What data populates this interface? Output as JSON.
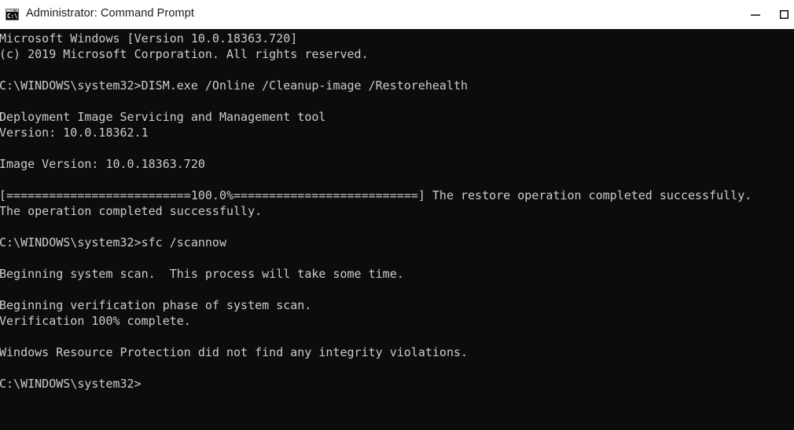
{
  "window": {
    "title": "Administrator: Command Prompt",
    "icon": "cmd-prompt-icon",
    "background_color": "#0c0c0c",
    "text_color": "#cccccc",
    "titlebar_color": "#ffffff",
    "titlebar_text_color": "#1a1a1a",
    "controls": {
      "minimize_label": "—",
      "maximize_label": "□",
      "minimize_name": "minimize-button",
      "maximize_name": "maximize-button"
    }
  },
  "console": {
    "prompt": "C:\\WINDOWS\\system32>",
    "lines": [
      "Microsoft Windows [Version 10.0.18363.720]",
      "(c) 2019 Microsoft Corporation. All rights reserved.",
      "",
      "C:\\WINDOWS\\system32>DISM.exe /Online /Cleanup-image /Restorehealth",
      "",
      "Deployment Image Servicing and Management tool",
      "Version: 10.0.18362.1",
      "",
      "Image Version: 10.0.18363.720",
      "",
      "[==========================100.0%==========================] The restore operation completed successfully.",
      "The operation completed successfully.",
      "",
      "C:\\WINDOWS\\system32>sfc /scannow",
      "",
      "Beginning system scan.  This process will take some time.",
      "",
      "Beginning verification phase of system scan.",
      "Verification 100% complete.",
      "",
      "Windows Resource Protection did not find any integrity violations.",
      "",
      "C:\\WINDOWS\\system32>"
    ],
    "full_text": "Microsoft Windows [Version 10.0.18363.720]\n(c) 2019 Microsoft Corporation. All rights reserved.\n\nC:\\WINDOWS\\system32>DISM.exe /Online /Cleanup-image /Restorehealth\n\nDeployment Image Servicing and Management tool\nVersion: 10.0.18362.1\n\nImage Version: 10.0.18363.720\n\n[==========================100.0%==========================] The restore operation completed successfully.\nThe operation completed successfully.\n\nC:\\WINDOWS\\system32>sfc /scannow\n\nBeginning system scan.  This process will take some time.\n\nBeginning verification phase of system scan.\nVerification 100% complete.\n\nWindows Resource Protection did not find any integrity violations.\n\nC:\\WINDOWS\\system32>",
    "commands_run": [
      "DISM.exe /Online /Cleanup-image /Restorehealth",
      "sfc /scannow"
    ],
    "dism": {
      "tool_name": "Deployment Image Servicing and Management tool",
      "version": "10.0.18362.1",
      "image_version": "10.0.18363.720",
      "progress_percent": "100.0%",
      "progress_result": "The restore operation completed successfully.",
      "result": "The operation completed successfully."
    },
    "sfc": {
      "scan_start": "Beginning system scan.  This process will take some time.",
      "verification_start": "Beginning verification phase of system scan.",
      "verification_progress": "Verification 100% complete.",
      "result": "Windows Resource Protection did not find any integrity violations."
    },
    "os_banner": {
      "product": "Microsoft Windows",
      "version": "[Version 10.0.18363.720]",
      "copyright": "(c) 2019 Microsoft Corporation. All rights reserved."
    }
  }
}
